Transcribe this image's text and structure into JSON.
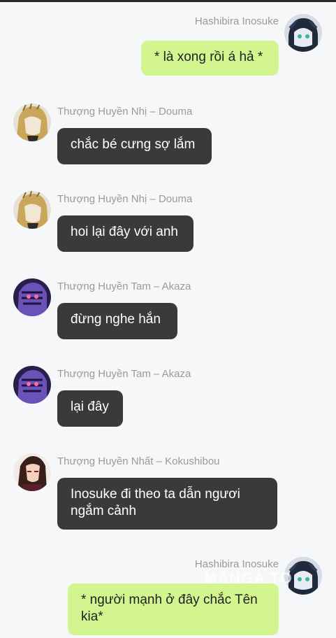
{
  "messages": [
    {
      "sender": "Hashibira Inosuke",
      "text": "* là xong rồi á hả *"
    },
    {
      "sender": "Thượng Huyền Nhị – Douma",
      "text": "chắc bé cưng sợ lắm"
    },
    {
      "sender": "Thượng Huyền Nhị – Douma",
      "text": "hoi lại đây với anh"
    },
    {
      "sender": "Thượng Huyền Tam – Akaza",
      "text": "đừng nghe hắn"
    },
    {
      "sender": "Thượng Huyền Tam – Akaza",
      "text": "lại đây"
    },
    {
      "sender": "Thượng Huyền Nhất – Kokushibou",
      "text": "Inosuke đi theo ta dẫn ngươi ngắm cảnh"
    },
    {
      "sender": "Hashibira Inosuke",
      "text": "* người mạnh ở đây chắc Tên kia*"
    }
  ],
  "watermark": "MANGA TO",
  "avatars": {
    "inosuke": "inosuke-avatar",
    "douma": "douma-avatar",
    "akaza": "akaza-avatar",
    "kokushibou": "kokushibou-avatar"
  },
  "colors": {
    "background": "#f6f7f9",
    "outgoing_bubble": "#d3f58f",
    "incoming_bubble": "#3a3a3a",
    "sender_name": "#9a9a9a"
  }
}
